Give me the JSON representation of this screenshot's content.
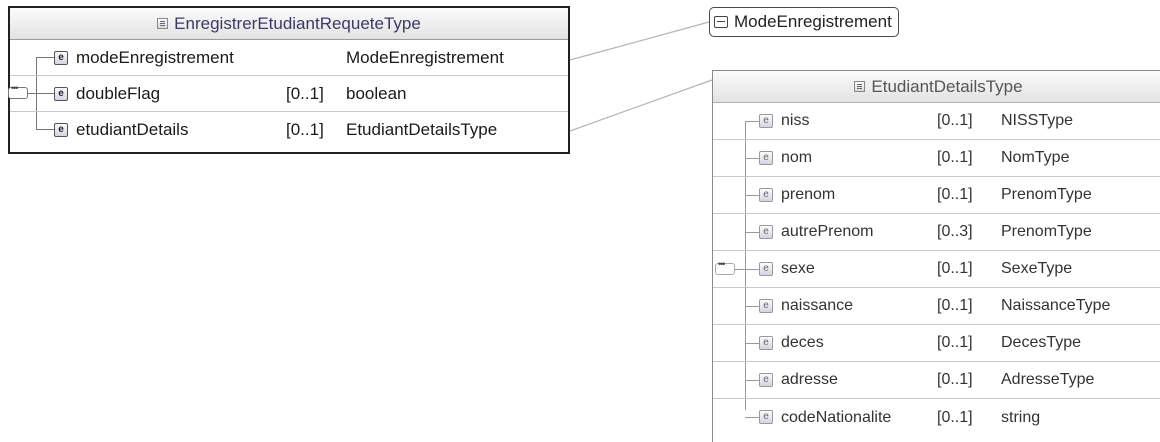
{
  "main_type": {
    "title": "EnregistrerEtudiantRequeteType",
    "elements": [
      {
        "name": "modeEnregistrement",
        "cardinality": "",
        "type": "ModeEnregistrement"
      },
      {
        "name": "doubleFlag",
        "cardinality": "[0..1]",
        "type": "boolean"
      },
      {
        "name": "etudiantDetails",
        "cardinality": "[0..1]",
        "type": "EtudiantDetailsType"
      }
    ]
  },
  "simple_type": {
    "title": "ModeEnregistrement"
  },
  "details_type": {
    "title": "EtudiantDetailsType",
    "elements": [
      {
        "name": "niss",
        "cardinality": "[0..1]",
        "type": "NISSType"
      },
      {
        "name": "nom",
        "cardinality": "[0..1]",
        "type": "NomType"
      },
      {
        "name": "prenom",
        "cardinality": "[0..1]",
        "type": "PrenomType"
      },
      {
        "name": "autrePrenom",
        "cardinality": "[0..3]",
        "type": "PrenomType"
      },
      {
        "name": "sexe",
        "cardinality": "[0..1]",
        "type": "SexeType"
      },
      {
        "name": "naissance",
        "cardinality": "[0..1]",
        "type": "NaissanceType"
      },
      {
        "name": "deces",
        "cardinality": "[0..1]",
        "type": "DecesType"
      },
      {
        "name": "adresse",
        "cardinality": "[0..1]",
        "type": "AdresseType"
      },
      {
        "name": "codeNationalite",
        "cardinality": "[0..1]",
        "type": "string"
      }
    ]
  },
  "icons": {
    "element": "element-icon",
    "complex_type": "complex-type-icon",
    "simple_type": "simple-type-icon",
    "sequence": "sequence-icon"
  },
  "element_icon_letter": "e"
}
